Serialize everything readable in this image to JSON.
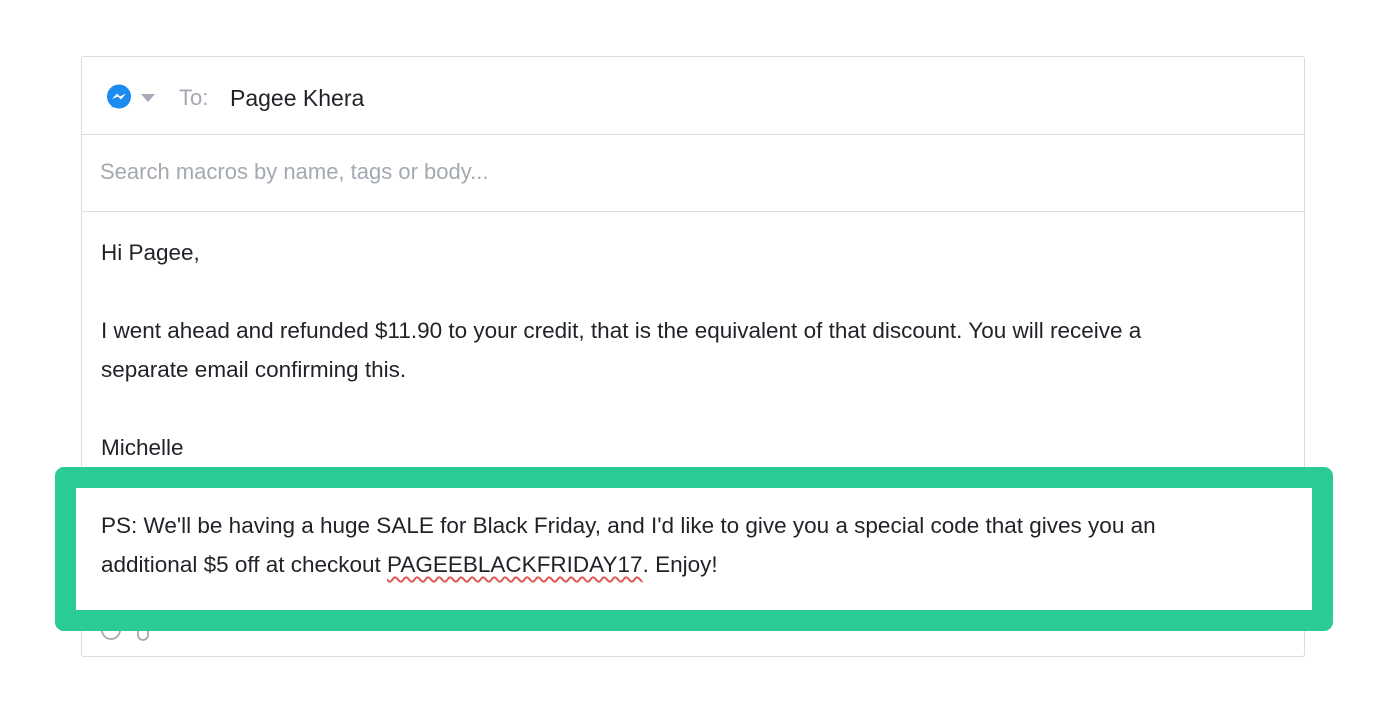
{
  "composer": {
    "channel_icon": "messenger-icon",
    "dropdown_icon": "caret-down-icon",
    "to_label": "To:",
    "to_value": "Pagee Khera",
    "search": {
      "placeholder": "Search macros by name, tags or body...",
      "value": ""
    },
    "body": {
      "greeting": "Hi Pagee,",
      "paragraph_line1": "I went ahead and refunded $11.90 to your credit, that is the equivalent of that discount. You will receive a",
      "paragraph_line2": "separate email confirming this.",
      "signature": "Michelle"
    },
    "ps": {
      "line1": "PS: We'll be having a huge SALE for Black Friday, and I'd like to give you a special code that gives you an",
      "line2_before": "additional $5 off at checkout ",
      "code": "PAGEEBLACKFRIDAY17",
      "line2_after": ". Enjoy!"
    },
    "footer_icons": [
      "emoji-icon",
      "attachment-icon"
    ]
  },
  "colors": {
    "highlight": "#2bcc94",
    "messenger": "#1a8cf0",
    "spellcheck": "#e05a5a"
  }
}
